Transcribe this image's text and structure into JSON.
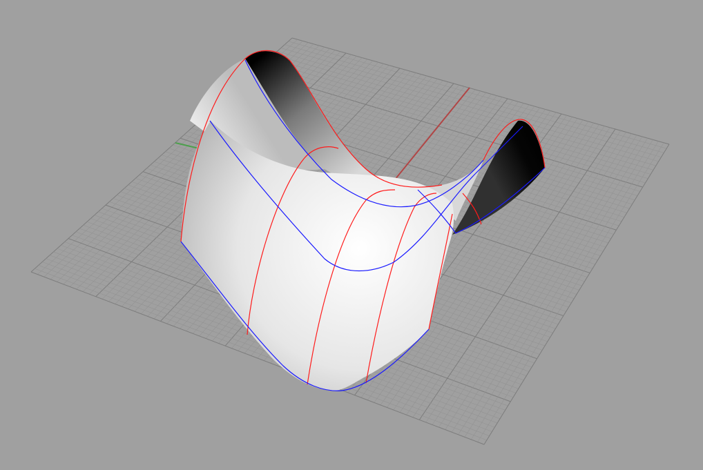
{
  "viewport": {
    "background_color": "#a0a0a0",
    "grid_minor_color": "#939393",
    "grid_major_color": "#7c7c7c",
    "x_axis_color": "#b14545",
    "y_axis_color": "#4ca04c",
    "surface_edge_color_u": "#ff1a1a",
    "surface_edge_color_v": "#1a1aff",
    "surface_light_color": "#ffffff",
    "surface_dark_color": "#000000",
    "object": "saddle-surface",
    "display_mode": "shaded"
  }
}
